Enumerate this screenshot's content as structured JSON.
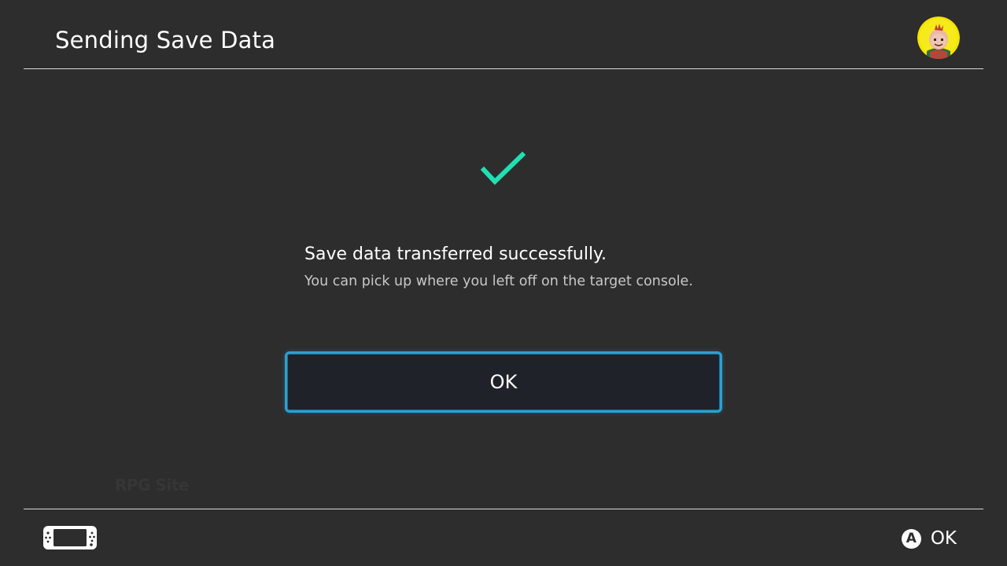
{
  "header": {
    "title": "Sending Save Data",
    "avatar_icon": "user-avatar-icon"
  },
  "main": {
    "status_icon": "checkmark-icon",
    "status_icon_color": "#1fe0b3",
    "message_title": "Save data transferred successfully.",
    "message_subtitle": "You can pick up where you left off on the target console.",
    "ok_button_label": "OK",
    "button_border_color": "#2f9fd0"
  },
  "watermark": {
    "text": "RPG Site"
  },
  "footer": {
    "console_icon": "handheld-console-icon",
    "a_button_glyph": "A",
    "action_label": "OK"
  },
  "colors": {
    "background": "#2d2d2d",
    "divider": "#d9d9d9",
    "accent": "#2f9fd0",
    "success": "#1fe0b3"
  }
}
